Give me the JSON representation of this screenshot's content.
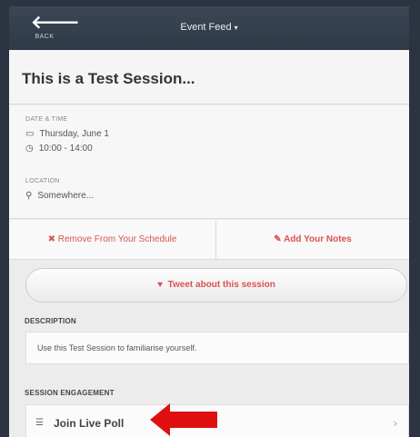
{
  "navbar": {
    "back_icon": "arrow-left-icon",
    "back_label": "BACK",
    "title": "Event Feed",
    "title_caret": "▾"
  },
  "session": {
    "title": "This is a Test Session...",
    "date_time_label": "DATE & TIME",
    "date": "Thursday, June 1",
    "time": "10:00 - 14:00",
    "location_label": "LOCATION",
    "location": "Somewhere..."
  },
  "actions": {
    "remove_label": "✖ Remove From Your Schedule",
    "notes_label": "✎ Add Your Notes"
  },
  "tweet": {
    "label": "Tweet about this session",
    "icon": "twitter-icon"
  },
  "description": {
    "header": "DESCRIPTION",
    "text": "Use this Test Session to familiarise yourself."
  },
  "engagement": {
    "header": "SESSION ENGAGEMENT",
    "poll_label": "Join Live Poll",
    "poll_icon": "list-icon"
  },
  "colors": {
    "accent": "#d9534f",
    "navbar": "#333e4b",
    "annotation_arrow": "#e01010"
  }
}
